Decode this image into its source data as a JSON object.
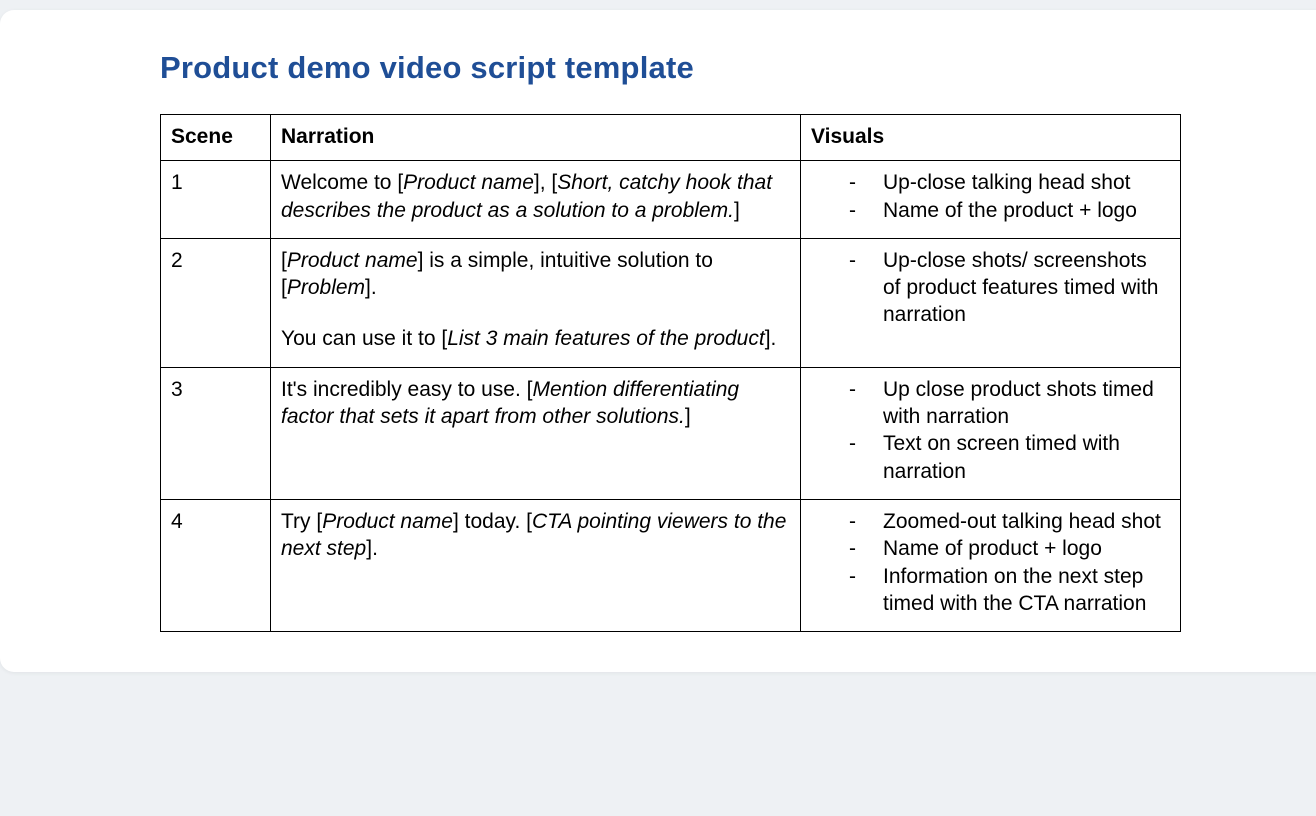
{
  "title": "Product demo video script template",
  "columns": {
    "scene": "Scene",
    "narration": "Narration",
    "visuals": "Visuals"
  },
  "rows": [
    {
      "scene": "1",
      "narration_parts": [
        [
          {
            "t": "Welcome to ["
          },
          {
            "t": "Product name",
            "i": true
          },
          {
            "t": "], ["
          },
          {
            "t": "Short, catchy hook that describes the product as a solution to a problem.",
            "i": true
          },
          {
            "t": "]"
          }
        ]
      ],
      "visuals": [
        "Up-close talking head shot",
        "Name of the product + logo"
      ]
    },
    {
      "scene": "2",
      "narration_parts": [
        [
          {
            "t": "["
          },
          {
            "t": "Product name",
            "i": true
          },
          {
            "t": "] is a simple, intuitive solution to ["
          },
          {
            "t": "Problem",
            "i": true
          },
          {
            "t": "]."
          }
        ],
        [
          {
            "t": "You can use it to ["
          },
          {
            "t": "List 3 main features of the product",
            "i": true
          },
          {
            "t": "]."
          }
        ]
      ],
      "visuals": [
        "Up-close shots/\nscreenshots of product features timed with narration"
      ]
    },
    {
      "scene": "3",
      "narration_parts": [
        [
          {
            "t": "It's incredibly easy to use. ["
          },
          {
            "t": "Mention differentiating factor that sets it apart from other solutions.",
            "i": true
          },
          {
            "t": "]"
          }
        ]
      ],
      "visuals": [
        "Up close product shots timed with narration",
        "Text on screen timed with narration"
      ]
    },
    {
      "scene": "4",
      "narration_parts": [
        [
          {
            "t": "Try ["
          },
          {
            "t": "Product name",
            "i": true
          },
          {
            "t": "] today. ["
          },
          {
            "t": "CTA pointing viewers to the next step",
            "i": true
          },
          {
            "t": "]."
          }
        ]
      ],
      "visuals": [
        "Zoomed-out talking head shot",
        "Name of product + logo",
        "Information on the next step timed with the CTA narration"
      ]
    }
  ]
}
